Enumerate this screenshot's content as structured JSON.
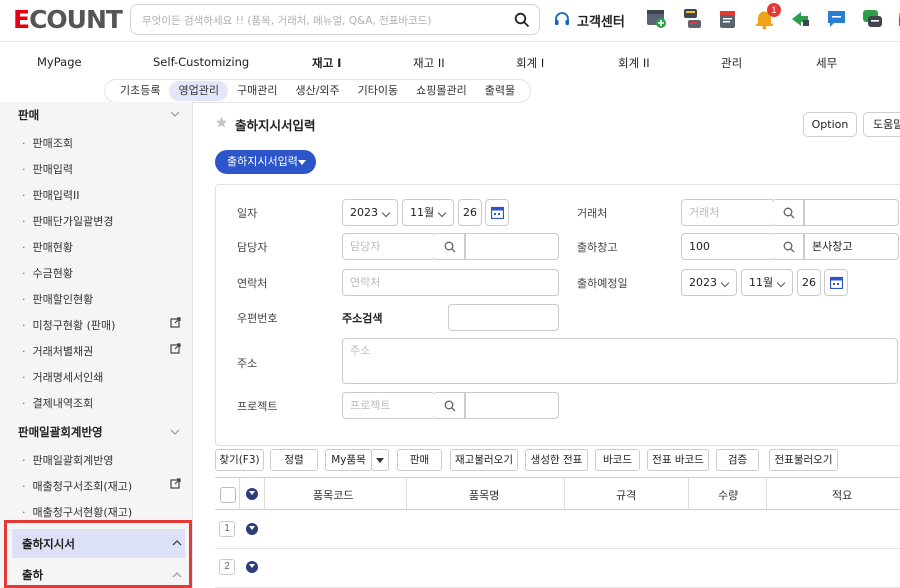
{
  "app": {
    "logo_e": "E",
    "logo_rest": "COUNT"
  },
  "search": {
    "placeholder": "무엇이든 검색하세요 !! (품목, 거래처, 메뉴얼, Q&A, 전표바코드)"
  },
  "support": {
    "label": "고객센터"
  },
  "notifications": {
    "count": "1"
  },
  "nav": {
    "items": [
      "MyPage",
      "Self-Customizing",
      "재고 I",
      "재고 II",
      "회계 I",
      "회계 II",
      "관리",
      "세무"
    ]
  },
  "subnav": {
    "items": [
      "기초등록",
      "영업관리",
      "구매관리",
      "생산/외주",
      "기타이동",
      "쇼핑몰관리",
      "출력물"
    ]
  },
  "sidebar": {
    "group1": "판매",
    "items1": [
      "판매조회",
      "판매입력",
      "판매입력II",
      "판매단가일괄변경",
      "판매현황",
      "수금현황",
      "판매할인현황",
      "미청구현황 (판매)",
      "거래처별채권",
      "거래명세서인쇄",
      "결제내역조회"
    ],
    "group2": "판매일괄회계반영",
    "items2": [
      "판매일괄회계반영",
      "매출청구서조회(재고)",
      "매출청구서현황(재고)"
    ],
    "group3": "출하지시서",
    "group4": "출하"
  },
  "page": {
    "title": "출하지시서입력",
    "option_label": "Option",
    "help_label": "도움말",
    "mode_label": "출하지시서입력"
  },
  "form": {
    "date_label": "일자",
    "date_year": "2023",
    "date_month": "11월",
    "date_day": "26",
    "customer_label": "거래처",
    "customer_placeholder": "거래처",
    "manager_label": "담당자",
    "manager_placeholder": "담당자",
    "warehouse_label": "출하창고",
    "warehouse_code": "100",
    "warehouse_name": "본사창고",
    "contact_label": "연락처",
    "contact_placeholder": "연락처",
    "ship_date_label": "출하예정일",
    "ship_year": "2023",
    "ship_month": "11월",
    "ship_day": "26",
    "zip_label": "우편번호",
    "zip_search": "주소검색",
    "address_label": "주소",
    "address_placeholder": "주소",
    "project_label": "프로젝트",
    "project_placeholder": "프로젝트"
  },
  "toolbar": {
    "buttons": [
      "찾기(F3)",
      "정렬",
      "My품목",
      "판매",
      "재고불러오기",
      "생성한 전표",
      "바코드",
      "전표 바코드",
      "검증",
      "전표불러오기"
    ]
  },
  "grid": {
    "columns": [
      "품목코드",
      "품목명",
      "규격",
      "수량",
      "적요"
    ],
    "rows": [
      "1",
      "2"
    ]
  }
}
